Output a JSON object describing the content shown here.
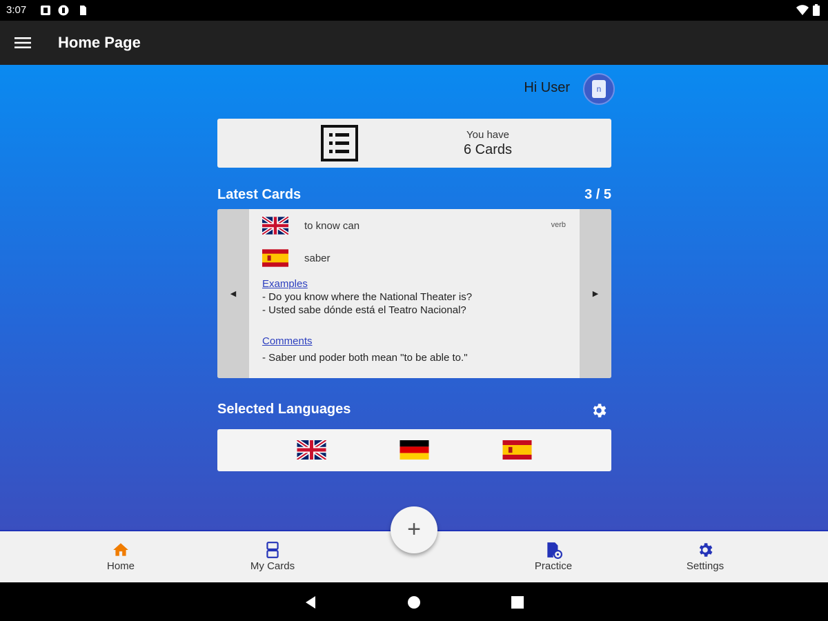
{
  "status_bar": {
    "time": "3:07",
    "icons": [
      "notification-icon",
      "app-icon",
      "sd-card-icon"
    ],
    "right_icons": [
      "wifi-icon",
      "battery-icon"
    ]
  },
  "app_bar": {
    "menu_icon": "hamburger-menu-icon",
    "title": "Home Page"
  },
  "header": {
    "greeting": "Hi User",
    "avatar_icon": "user-avatar-icon"
  },
  "card_summary": {
    "icon": "list-icon",
    "label": "You have",
    "count": "6 Cards"
  },
  "latest_cards": {
    "title": "Latest Cards",
    "page": "3 / 5",
    "card": {
      "source_flag": "uk-flag-icon",
      "source_word": "to know can",
      "word_type": "verb",
      "target_flag": "spain-flag-icon",
      "target_word": "saber",
      "examples_label": "Examples",
      "examples": [
        "- Do you know where the National Theater is?",
        "- Usted sabe dónde está el Teatro Nacional?"
      ],
      "comments_label": "Comments",
      "comments": [
        "- Saber und poder both mean \"to be able to.\""
      ]
    }
  },
  "selected_languages": {
    "title": "Selected Languages",
    "settings_icon": "gear-icon",
    "flags": [
      "uk-flag-icon",
      "germany-flag-icon",
      "spain-flag-icon"
    ]
  },
  "fab": {
    "label": "+"
  },
  "bottom_nav": {
    "active_color": "#f07c00",
    "accent_color": "#2433b8",
    "items": [
      {
        "label": "Home",
        "icon": "home-icon",
        "active": true
      },
      {
        "label": "My Cards",
        "icon": "cards-icon",
        "active": false
      },
      {
        "label": "Practice",
        "icon": "practice-icon",
        "active": false
      },
      {
        "label": "Settings",
        "icon": "gear-icon",
        "active": false
      }
    ]
  },
  "system_nav": [
    "back-icon",
    "home-circle-icon",
    "recents-icon"
  ]
}
